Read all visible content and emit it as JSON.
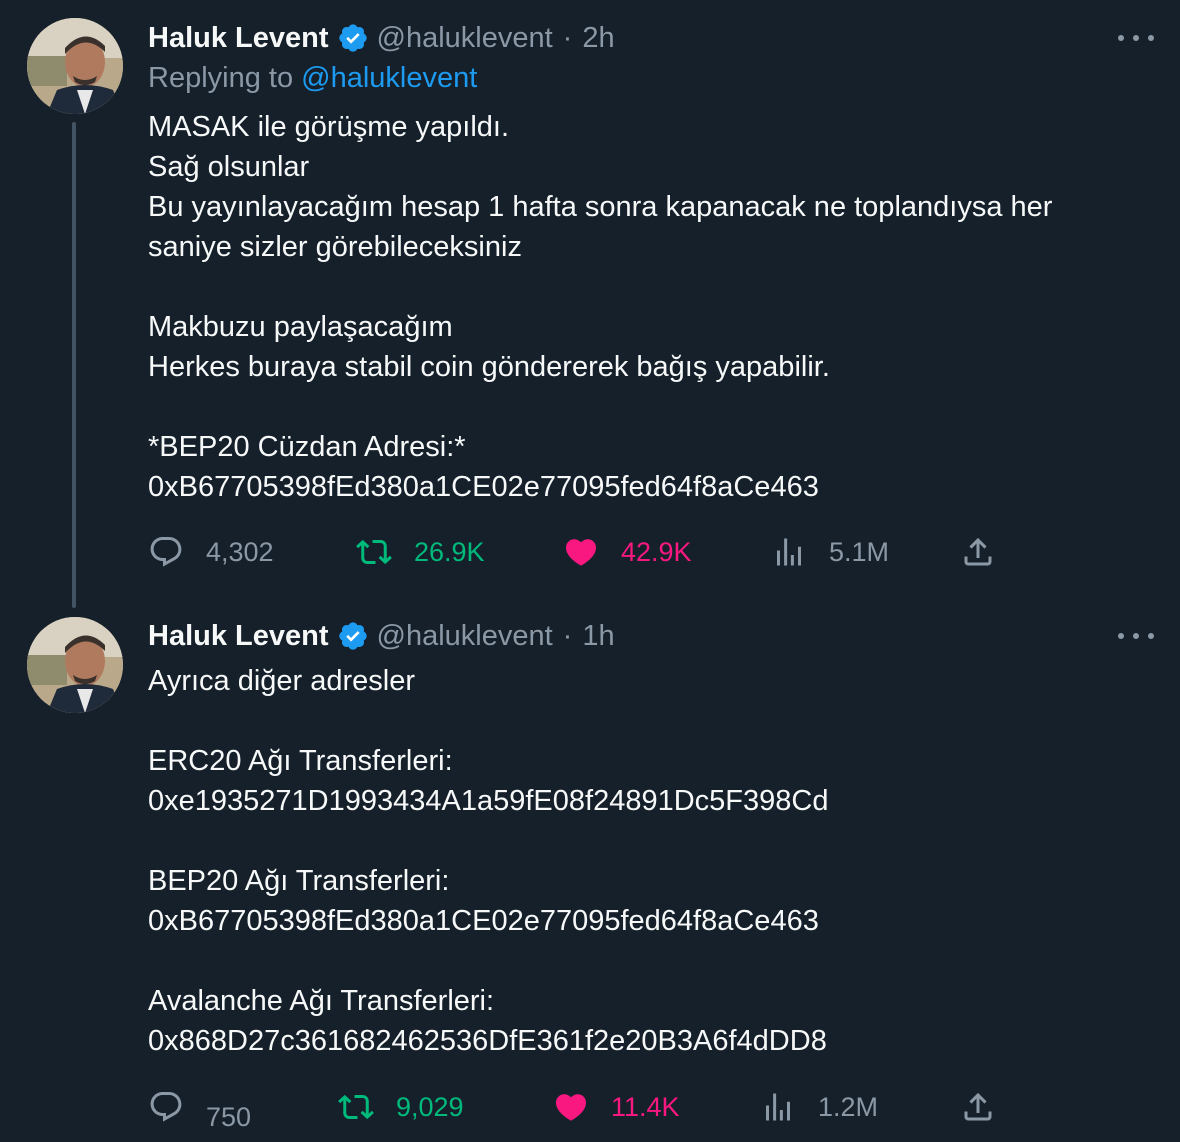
{
  "tweets": [
    {
      "author_name": "Haluk Levent",
      "handle": "@haluklevent",
      "separator": "·",
      "time": "2h",
      "replying_prefix": "Replying to ",
      "replying_handle": "@haluklevent",
      "lines": [
        "MASAK ile görüşme yapıldı.",
        "Sağ olsunlar",
        "Bu yayınlayacağım hesap 1 hafta sonra kapanacak ne toplandıysa her",
        "saniye sizler görebileceksiniz",
        "",
        "Makbuzu paylaşacağım",
        "Herkes buraya stabil coin göndererek bağış yapabilir.",
        "",
        "*BEP20 Cüzdan Adresi:*",
        "0xB67705398fEd380a1CE02e77095fed64f8aCe463"
      ],
      "stats": {
        "replies": "4,302",
        "retweets": "26.9K",
        "likes": "42.9K",
        "views": "5.1M"
      }
    },
    {
      "author_name": "Haluk Levent",
      "handle": "@haluklevent",
      "separator": "·",
      "time": "1h",
      "lines": [
        "Ayrıca diğer adresler",
        "",
        "ERC20 Ağı Transferleri:",
        "0xe1935271D1993434A1a59fE08f24891Dc5F398Cd",
        "",
        "BEP20 Ağı Transferleri:",
        "0xB67705398fEd380a1CE02e77095fed64f8aCe463",
        "",
        "Avalanche Ağı Transferleri:",
        "0x868D27c361682462536DfE361f2e20B3A6f4dDD8"
      ],
      "stats": {
        "replies": "750",
        "retweets": "9,029",
        "likes": "11.4K",
        "views": "1.2M"
      }
    }
  ],
  "colors": {
    "background": "#15202b",
    "text_primary": "#f7f9f9",
    "text_secondary": "#8b98a5",
    "link": "#1d9bf0",
    "verified": "#1d9bf0",
    "retweet": "#00ba7c",
    "like": "#f91880",
    "thread_line": "#425364"
  },
  "icons": [
    "verified-badge-icon",
    "more-icon",
    "reply-icon",
    "retweet-icon",
    "like-icon",
    "views-icon",
    "share-icon"
  ]
}
